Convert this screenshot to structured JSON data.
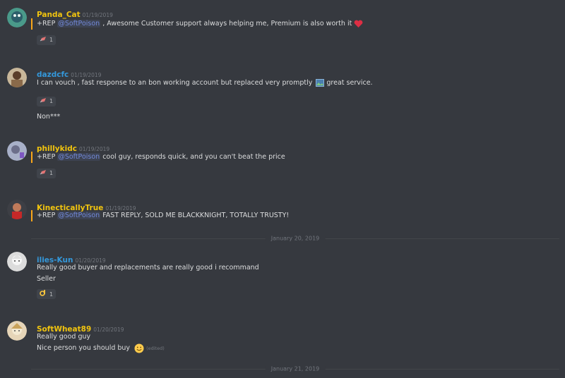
{
  "messages": [
    {
      "author": "Panda_Cat",
      "author_color": "#f1c40f",
      "timestamp": "01/19/2019",
      "lines": [
        {
          "pre": "+REP ",
          "mention": "@SoftPoison",
          "post": " , Awesome Customer support always helping me, Premium is also worth it",
          "highlight": true,
          "emoji": "heart-icon"
        }
      ],
      "reaction": {
        "emoji": "rocket-icon",
        "count": "1"
      }
    },
    {
      "author": "dazdcfc",
      "author_color": "#3498db",
      "timestamp": "01/19/2019",
      "lines": [
        {
          "text": "I can vouch , fast response to an bon working account but replaced very promptly",
          "after": " great service."
        },
        {
          "text": "Non***"
        }
      ],
      "reaction": {
        "emoji": "rocket-icon",
        "count": "1"
      }
    },
    {
      "author": "phillykidc",
      "author_color": "#f1c40f",
      "timestamp": "01/19/2019",
      "lines": [
        {
          "pre": "+REP ",
          "mention": "@SoftPoison",
          "post": " cool guy, responds quick, and you can't beat the price",
          "highlight": true
        }
      ],
      "reaction": {
        "emoji": "rocket-icon",
        "count": "1"
      }
    },
    {
      "author": "KinecticallyTrue",
      "author_color": "#f1c40f",
      "timestamp": "01/19/2019",
      "lines": [
        {
          "pre": "+REP ",
          "mention": "@SoftPoison",
          "post": "  FAST REPLY, SOLD ME BLACKKNIGHT, TOTALLY TRUSTY!",
          "highlight": true
        }
      ]
    },
    {
      "author": "ilies-Kun",
      "author_color": "#3498db",
      "timestamp": "01/20/2019",
      "lines": [
        {
          "text": "Really good buyer and replacements are really good i recommand"
        },
        {
          "text": "Seller"
        }
      ],
      "reaction": {
        "emoji": "ok-hand-icon",
        "count": "1"
      }
    },
    {
      "author": "SoftWheat89",
      "author_color": "#f1c40f",
      "timestamp": "01/20/2019",
      "lines": [
        {
          "text": "Really good guy"
        },
        {
          "text": "Nice person you  should buy",
          "emoji": "smile-icon",
          "edited": "(edited)"
        }
      ]
    }
  ],
  "dividers": [
    "January 20, 2019",
    "January 21, 2019"
  ]
}
